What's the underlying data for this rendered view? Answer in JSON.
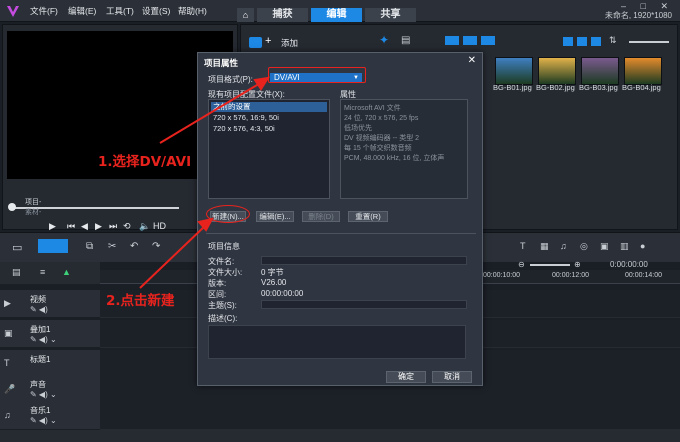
{
  "menubar": {
    "items": [
      "文件(F)",
      "编辑(E)",
      "工具(T)",
      "设置(S)",
      "帮助(H)"
    ],
    "home_icon": "home-icon",
    "tabs": [
      "捕获",
      "编辑",
      "共享"
    ],
    "active_tab": "编辑",
    "project_name": "未命名, 1920*1080"
  },
  "player": {
    "project_label": "项目-",
    "clip_label": "素材-",
    "hd_label": "HD"
  },
  "library": {
    "add_label": "添加",
    "thumbnails": [
      {
        "label": "BG-B01.jpg",
        "color": "#3f7fc2"
      },
      {
        "label": "BG-B02.jpg",
        "color": "#e1b24a"
      },
      {
        "label": "BG-B03.jpg",
        "color": "#7a5a8e"
      },
      {
        "label": "BG-B04.jpg",
        "color": "#e48b2c"
      }
    ]
  },
  "timeline": {
    "ruler_ticks": [
      "00:00:10:00",
      "00:00:12:00",
      "00:00:14:00"
    ],
    "time_display": "0:00:00:00",
    "tracks": [
      {
        "name": "视频",
        "icon": "film-icon"
      },
      {
        "name": "叠加1",
        "icon": "overlay-icon"
      },
      {
        "name": "标题1",
        "icon": "title-icon"
      },
      {
        "name": "声音",
        "icon": "voice-icon"
      },
      {
        "name": "音乐1",
        "icon": "music-icon"
      }
    ]
  },
  "dialog": {
    "title": "项目属性",
    "format_label": "项目格式(P):",
    "format_value": "DV/AVI",
    "profiles_label": "现有项目配置文件(X):",
    "profiles": [
      "之前的设置",
      "720 x 576, 16:9, 50i",
      "720 x 576, 4:3, 50i"
    ],
    "selected_profile": "之前的设置",
    "props_label": "属性",
    "props": [
      "Microsoft AVI 文件",
      "24 位, 720 x 576, 25 fps",
      "低场优先",
      "DV 视频编码器 -- 类型 2",
      "每 15 个帧交织数音频",
      "PCM, 48.000 kHz, 16 位, 立体声"
    ],
    "buttons": {
      "new": "新建(N)...",
      "edit": "编辑(E)...",
      "delete": "删除(D)",
      "reset": "重置(R)"
    },
    "info_label": "项目信息",
    "info": {
      "filename_label": "文件名:",
      "filesize_label": "文件大小:",
      "filesize_value": "0 字节",
      "version_label": "版本:",
      "version_value": "V26.00",
      "duration_label": "区间:",
      "duration_value": "00:00:00:00",
      "subject_label": "主题(S):",
      "desc_label": "描述(C):"
    },
    "ok": "确定",
    "cancel": "取消"
  },
  "annotations": {
    "step1": "1.选择DV/AVI",
    "step2": "2.点击新建",
    "color": "#e8231e"
  }
}
